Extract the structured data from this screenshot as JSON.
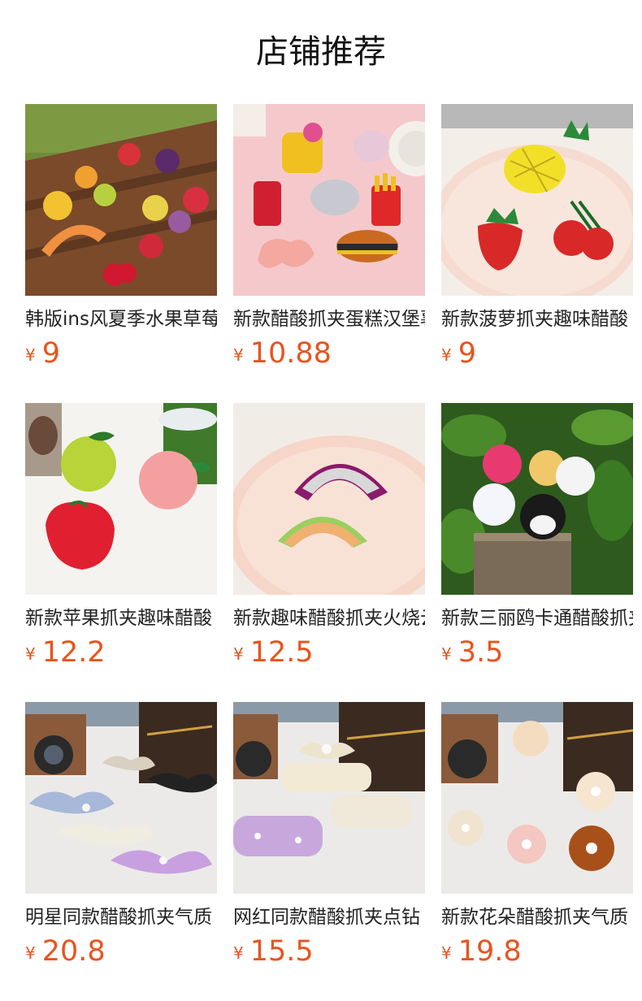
{
  "header": {
    "title": "店铺推荐"
  },
  "colors": {
    "price": "#e8541e",
    "title": "#222222"
  },
  "products": [
    {
      "title": "韩版ins风夏季水果草莓抓夹",
      "currency": "¥",
      "price": "9",
      "image_icon": "fruit-clips-image"
    },
    {
      "title": "新款醋酸抓夹蛋糕汉堡薯条",
      "currency": "¥",
      "price": "10.88",
      "image_icon": "food-clips-image"
    },
    {
      "title": "新款菠萝抓夹趣味醋酸",
      "currency": "¥",
      "price": "9",
      "image_icon": "pineapple-clips-image"
    },
    {
      "title": "新款苹果抓夹趣味醋酸",
      "currency": "¥",
      "price": "12.2",
      "image_icon": "apple-clips-image"
    },
    {
      "title": "新款趣味醋酸抓夹火烧云",
      "currency": "¥",
      "price": "12.5",
      "image_icon": "rainbow-clips-image"
    },
    {
      "title": "新款三丽鸥卡通醋酸抓夹",
      "currency": "¥",
      "price": "3.5",
      "image_icon": "cartoon-clips-image"
    },
    {
      "title": "明星同款醋酸抓夹气质",
      "currency": "¥",
      "price": "20.8",
      "image_icon": "bow-clips-image"
    },
    {
      "title": "网红同款醋酸抓夹点钻",
      "currency": "¥",
      "price": "15.5",
      "image_icon": "pearl-clips-image"
    },
    {
      "title": "新款花朵醋酸抓夹气质",
      "currency": "¥",
      "price": "19.8",
      "image_icon": "flower-clips-image"
    }
  ]
}
